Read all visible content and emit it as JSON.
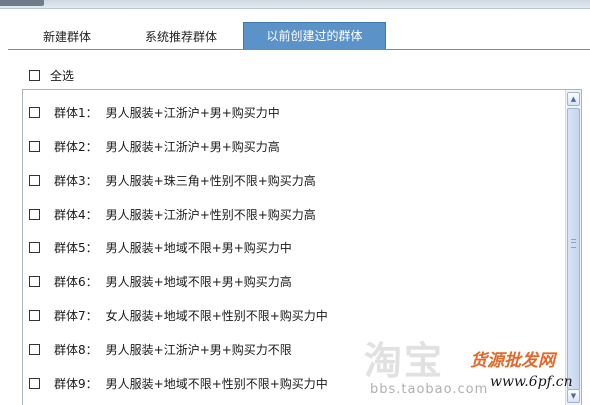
{
  "tabs": [
    {
      "label": "新建群体",
      "active": false
    },
    {
      "label": "系统推荐群体",
      "active": false
    },
    {
      "label": "以前创建过的群体",
      "active": true
    }
  ],
  "select_all_label": "全选",
  "groups": [
    {
      "name": "群体1：",
      "desc": "男人服装+江浙沪+男+购买力中"
    },
    {
      "name": "群体2：",
      "desc": "男人服装+江浙沪+男+购买力高"
    },
    {
      "name": "群体3：",
      "desc": "男人服装+珠三角+性别不限+购买力高"
    },
    {
      "name": "群体4：",
      "desc": "男人服装+江浙沪+性别不限+购买力高"
    },
    {
      "name": "群体5：",
      "desc": "男人服装+地域不限+男+购买力中"
    },
    {
      "name": "群体6：",
      "desc": "男人服装+地域不限+男+购买力高"
    },
    {
      "name": "群体7：",
      "desc": "女人服装+地域不限+性别不限+购买力中"
    },
    {
      "name": "群体8：",
      "desc": "男人服装+江浙沪+男+购买力不限"
    },
    {
      "name": "群体9：",
      "desc": "男人服装+地域不限+性别不限+购买力中"
    }
  ],
  "watermark": {
    "taobao": "淘宝",
    "taobao_url": "bbs.taobao.com",
    "brand": "货源批发网",
    "site": "www.6pf.cn"
  },
  "icons": {
    "scroll_up": "scroll-up-arrow-icon",
    "scroll_down": "scroll-down-arrow-icon"
  },
  "colors": {
    "active_tab": "#5b93c9",
    "tab_line": "#5d8fc4",
    "brand_watermark": "#e26a2c"
  }
}
